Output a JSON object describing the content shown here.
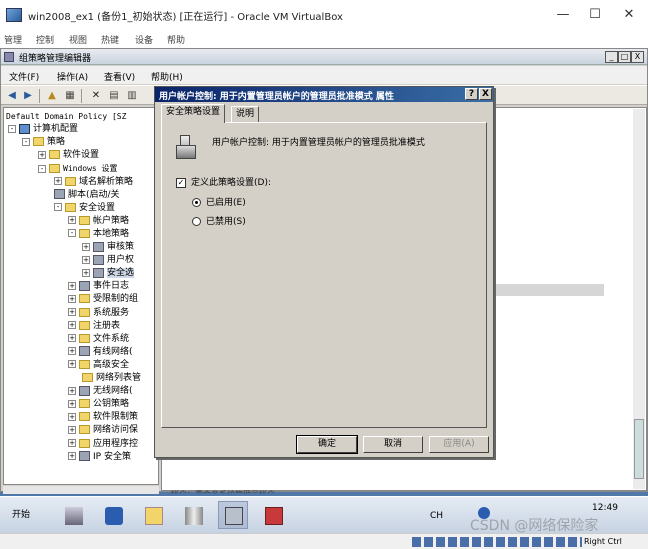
{
  "vbox": {
    "title": "win2008_ex1 (备份1_初始状态) [正在运行] - Oracle VM VirtualBox",
    "minimize": "—",
    "maximize": "☐",
    "close": "✕",
    "menu": [
      "管理",
      "控制",
      "视图",
      "热键",
      "设备",
      "帮助"
    ],
    "status_hotkey": "Right Ctrl"
  },
  "gpme": {
    "title": "组策略管理编辑器",
    "menu": [
      "文件(F)",
      "操作(A)",
      "查看(V)",
      "帮助(H)"
    ],
    "btn_min": "_",
    "btn_max": "□",
    "btn_close": "X"
  },
  "tree": {
    "root": "Default Domain Policy [SZ",
    "items": [
      "计算机配置",
      "策略",
      "软件设置",
      "Windows 设置",
      "域名解析策略",
      "脚本(启动/关",
      "安全设置",
      "帐户策略",
      "本地策略",
      "审核策",
      "用户权",
      "安全选",
      "事件日志",
      "受限制的组",
      "系统服务",
      "注册表",
      "文件系统",
      "有线网络(",
      "高级安全",
      "网络列表管",
      "无线网络(",
      "公钥策略",
      "软件限制策",
      "网络访问保",
      "应用程序控",
      "IP 安全策"
    ]
  },
  "right_pane": {
    "bottom_text": "帐户：重命名系统管理员帐户"
  },
  "dialog": {
    "title": "用户帐户控制: 用于内置管理员帐户的管理员批准模式 属性",
    "help_btn": "?",
    "close_btn": "X",
    "tabs": [
      "安全策略设置",
      "说明"
    ],
    "policy_name": "用户帐户控制: 用于内置管理员帐户的管理员批准模式",
    "define_label": "定义此策略设置(D):",
    "define_checked": true,
    "enabled_label": "已启用(E)",
    "disabled_label": "已禁用(S)",
    "enabled_selected": true,
    "ok": "确定",
    "cancel": "取消",
    "apply": "应用(A)"
  },
  "taskbar": {
    "start": "开始",
    "tray_lang": "CH",
    "clock": "12:49"
  },
  "watermark": "CSDN @网络保险家"
}
